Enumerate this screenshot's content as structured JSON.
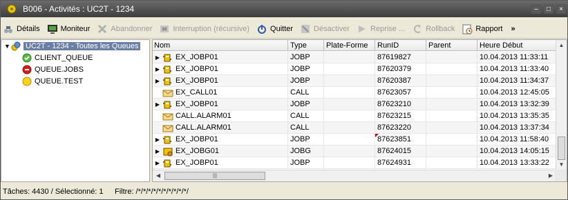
{
  "window": {
    "title": "B006 - Activités : UC2T - 1234"
  },
  "toolbar": {
    "buttons": [
      {
        "label": "Détails",
        "icon": "details-icon",
        "enabled": true
      },
      {
        "label": "Moniteur",
        "icon": "monitor-icon",
        "enabled": true
      },
      {
        "label": "Abandonner",
        "icon": "cancel-x-icon",
        "enabled": false
      },
      {
        "label": "Interruption (récursive)",
        "icon": "interrupt-icon",
        "enabled": false
      },
      {
        "label": "Quitter",
        "icon": "quit-icon",
        "enabled": true
      },
      {
        "label": "Désactiver",
        "icon": "deactivate-icon",
        "enabled": false
      },
      {
        "label": "Reprise ...",
        "icon": "restart-icon",
        "enabled": false
      },
      {
        "label": "Rollback",
        "icon": "rollback-icon",
        "enabled": false
      },
      {
        "label": "Rapport",
        "icon": "report-icon",
        "enabled": true
      }
    ],
    "more": "»"
  },
  "tree": {
    "root": {
      "label": "UC2T - 1234 - Toutes les Queues",
      "icon": "queue-group-icon"
    },
    "children": [
      {
        "label": "CLIENT_QUEUE",
        "icon": "status-green-check-icon"
      },
      {
        "label": "QUEUE.JOBS",
        "icon": "status-red-stop-icon"
      },
      {
        "label": "QUEUE.TEST",
        "icon": "status-yellow-icon"
      }
    ]
  },
  "grid": {
    "columns": [
      "Nom",
      "Type",
      "Plate-Forme",
      "RunID",
      "Parent",
      "Heure Début"
    ],
    "rows": [
      {
        "expand": true,
        "icon": "jobp-icon",
        "name": "EX_JOBP01",
        "type": "JOBP",
        "platform": "",
        "runid": "87619827",
        "parent": "",
        "start": "10.04.2013 11:33:11",
        "flag": false
      },
      {
        "expand": true,
        "icon": "jobp-icon",
        "name": "EX_JOBP01",
        "type": "JOBP",
        "platform": "",
        "runid": "87620379",
        "parent": "",
        "start": "10.04.2013 11:33:40",
        "flag": false
      },
      {
        "expand": true,
        "icon": "jobp-icon",
        "name": "EX_JOBP01",
        "type": "JOBP",
        "platform": "",
        "runid": "87620387",
        "parent": "",
        "start": "10.04.2013 11:34:37",
        "flag": false
      },
      {
        "expand": false,
        "icon": "call-envelope-icon",
        "name": "EX_CALL01",
        "type": "CALL",
        "platform": "",
        "runid": "87623057",
        "parent": "",
        "start": "10.04.2013 12:45:05",
        "flag": false
      },
      {
        "expand": true,
        "icon": "jobp-icon",
        "name": "EX_JOBP01",
        "type": "JOBP",
        "platform": "",
        "runid": "87623210",
        "parent": "",
        "start": "10.04.2013 13:32:39",
        "flag": false
      },
      {
        "expand": false,
        "icon": "call-envelope-icon",
        "name": "CALL.ALARM01",
        "type": "CALL",
        "platform": "",
        "runid": "87623215",
        "parent": "",
        "start": "10.04.2013 13:35:35",
        "flag": false
      },
      {
        "expand": false,
        "icon": "call-envelope-icon",
        "name": "CALL.ALARM01",
        "type": "CALL",
        "platform": "",
        "runid": "87623220",
        "parent": "",
        "start": "10.04.2013 13:37:34",
        "flag": false
      },
      {
        "expand": true,
        "icon": "jobp-icon",
        "name": "EX_JOBP01",
        "type": "JOBP",
        "platform": "",
        "runid": "87623851",
        "parent": "",
        "start": "10.04.2013 11:58:40",
        "flag": true
      },
      {
        "expand": true,
        "icon": "jobg-icon",
        "name": "EX_JOBG01",
        "type": "JOBG",
        "platform": "",
        "runid": "87624015",
        "parent": "",
        "start": "10.04.2013 14:05:15",
        "flag": false
      },
      {
        "expand": true,
        "icon": "jobp-icon",
        "name": "EX_JOBP01",
        "type": "JOBP",
        "platform": "",
        "runid": "87624931",
        "parent": "",
        "start": "10.04.2013 13:33:22",
        "flag": false
      }
    ]
  },
  "status": {
    "tasks": "Tâches: 4430 / Sélectionné: 1",
    "filter": "Filtre: /*/*/*/*/*/*/*/*/*/*/"
  }
}
